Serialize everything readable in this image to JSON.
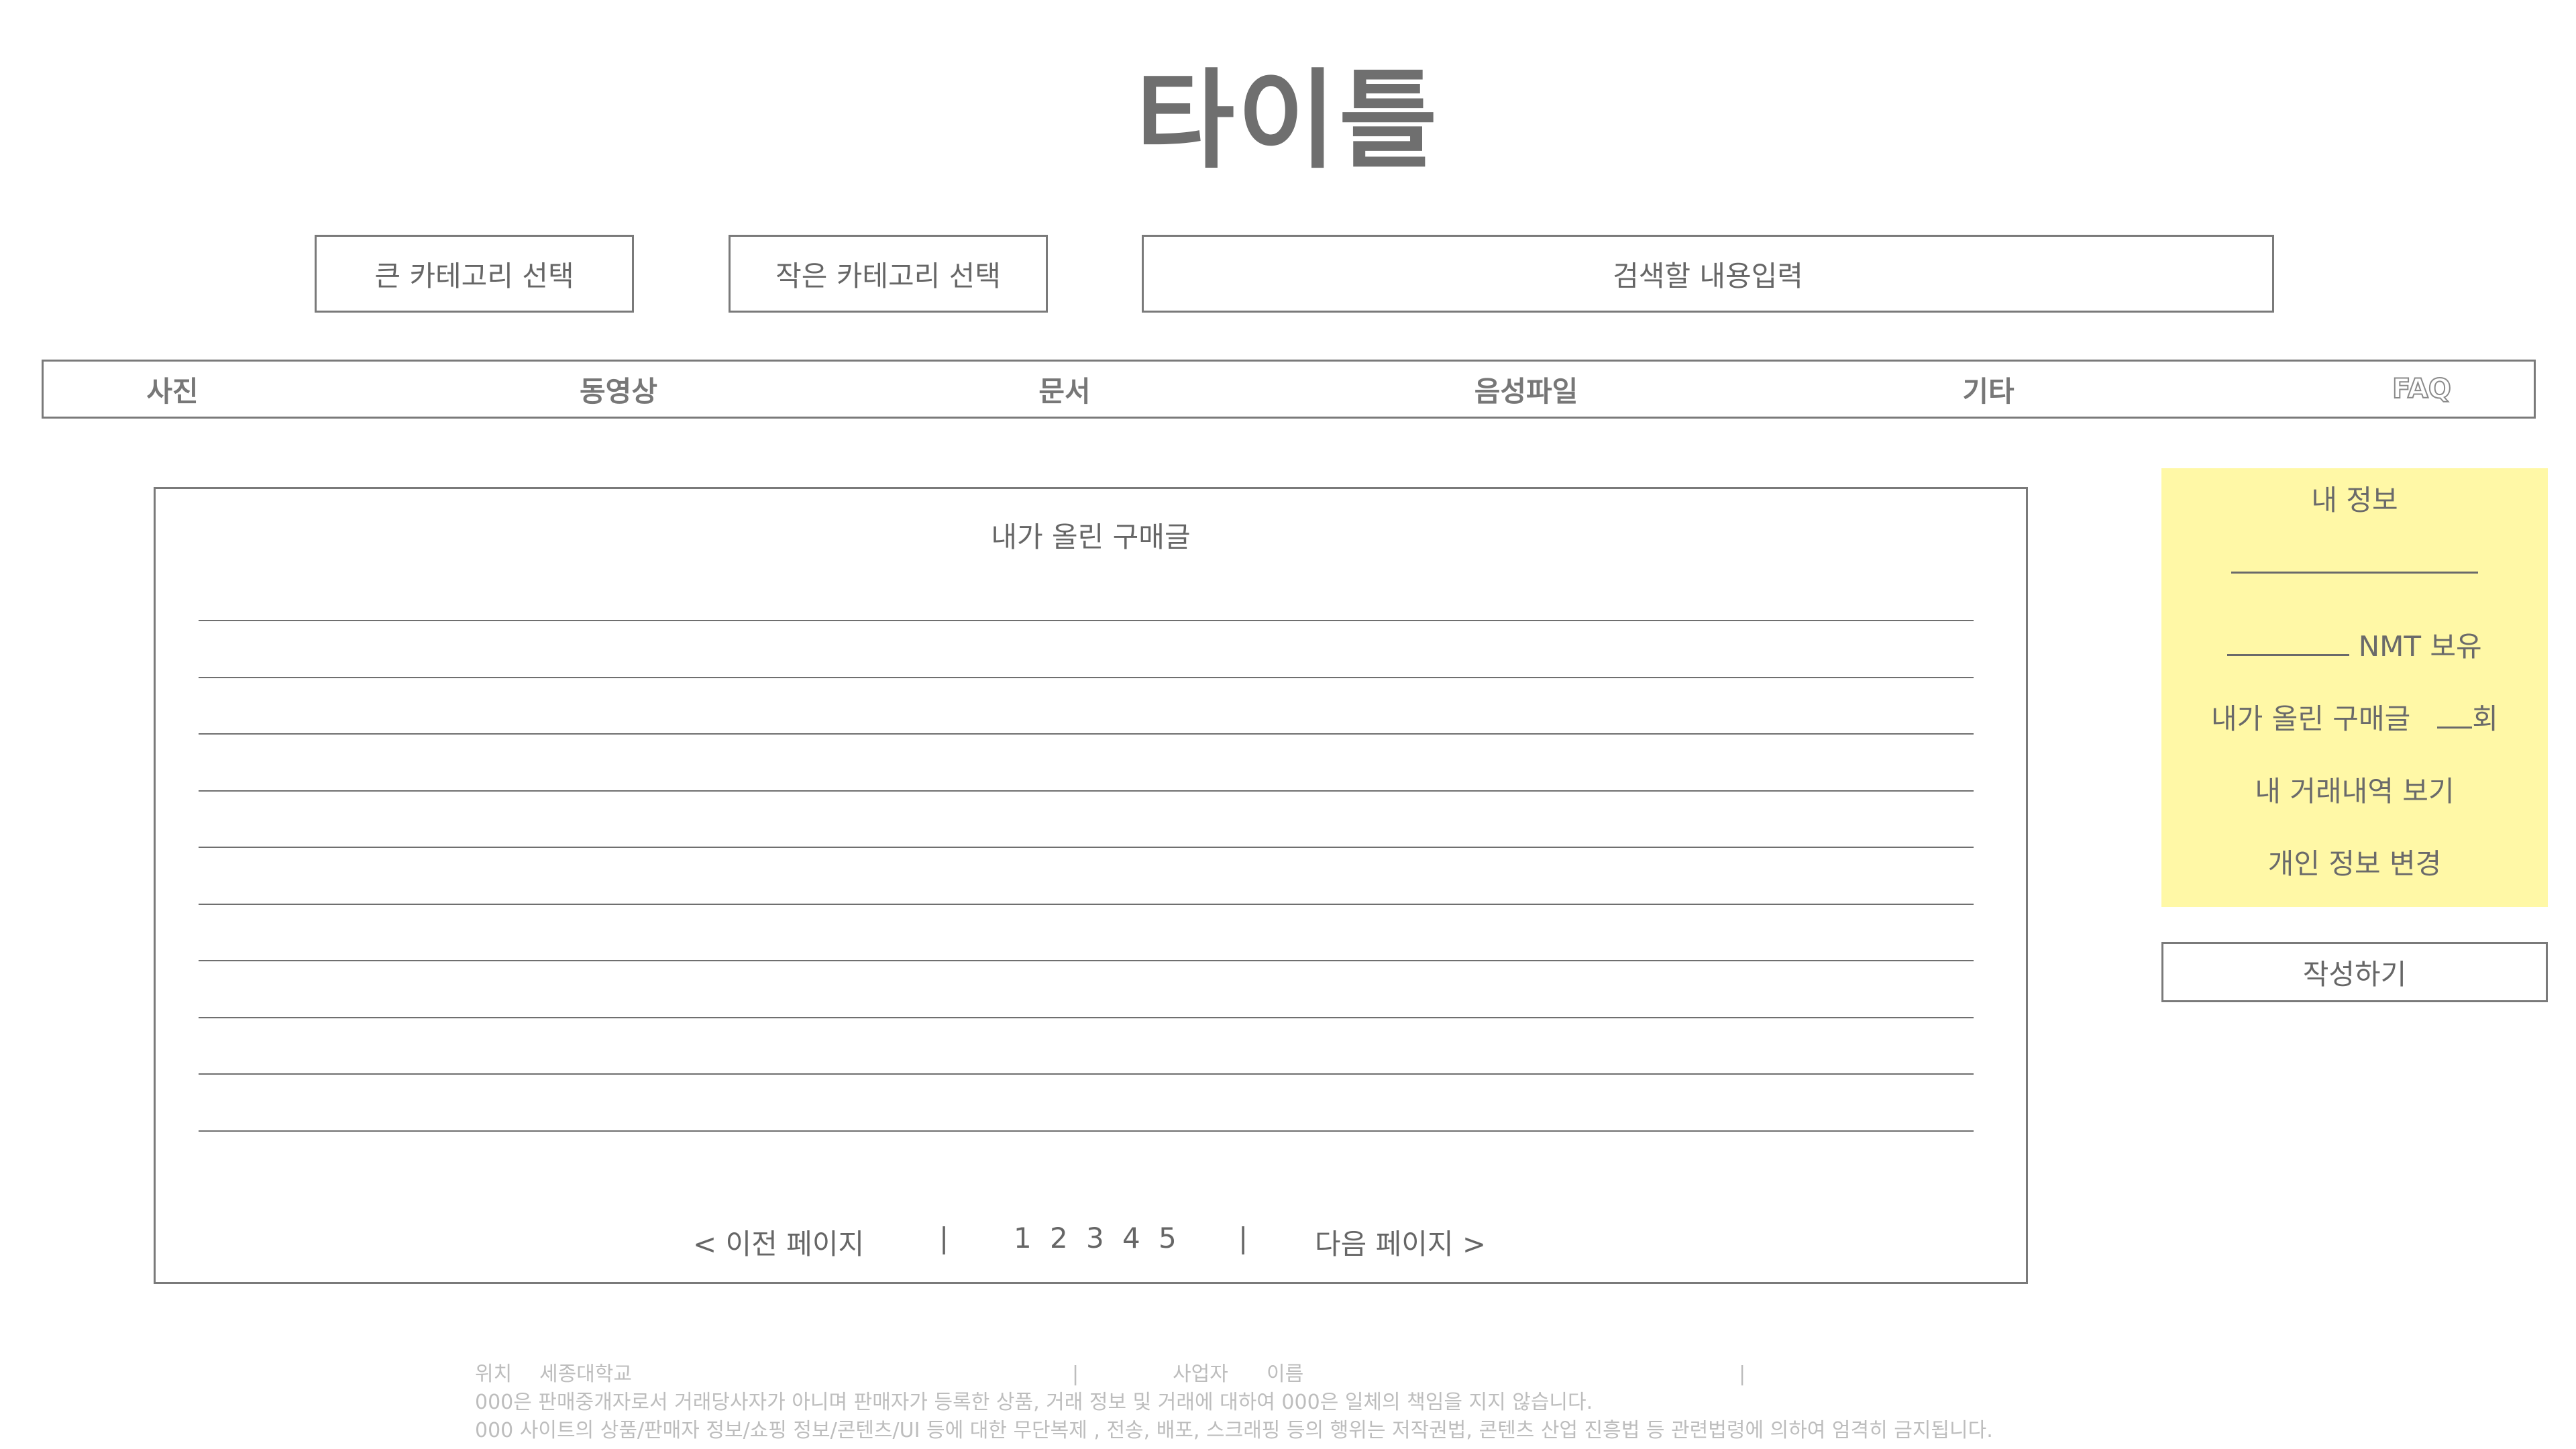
{
  "title": "타이틀",
  "search_bar": {
    "big_category": "큰 카테고리 선택",
    "small_category": "작은 카테고리 선택",
    "search_placeholder": "검색할 내용입력"
  },
  "nav": {
    "items": [
      "사진",
      "동영상",
      "문서",
      "음성파일",
      "기타",
      "FAQ"
    ]
  },
  "main": {
    "panel_title": "내가 올린 구매글",
    "row_count": 10,
    "pager": {
      "prev": "< 이전 페이지",
      "separator": "|",
      "pages": [
        "1",
        "2",
        "3",
        "4",
        "5"
      ],
      "next": "다음 페이지 >"
    }
  },
  "sidebar": {
    "my_info": "내 정보",
    "nmt_suffix": "NMT 보유",
    "my_posts_label": "내가 올린 구매글",
    "my_posts_suffix": "회",
    "history": "내 거래내역 보기",
    "edit_profile": "개인 정보 변경",
    "write_button": "작성하기",
    "bg_color": "#fff8a6"
  },
  "footer": {
    "location_label": "위치",
    "location_value": "세종대학교",
    "separator": "|",
    "business_label": "사업자",
    "name_label": "이름",
    "disclaimer": "000은 판매중개자로서 거래당사자가 아니며 판매자가 등록한 상품, 거래 정보 및 거래에 대하여 000은 일체의 책임을 지지 않습니다.",
    "copyright": "000 사이트의 상품/판매자 정보/쇼핑 정보/콘텐츠/UI 등에 대한 무단복제 , 전송, 배포, 스크래핑 등의 행위는 저작권법, 콘텐츠 산업 진흥법 등 관련법령에 의하여 엄격히 금지됩니다."
  }
}
